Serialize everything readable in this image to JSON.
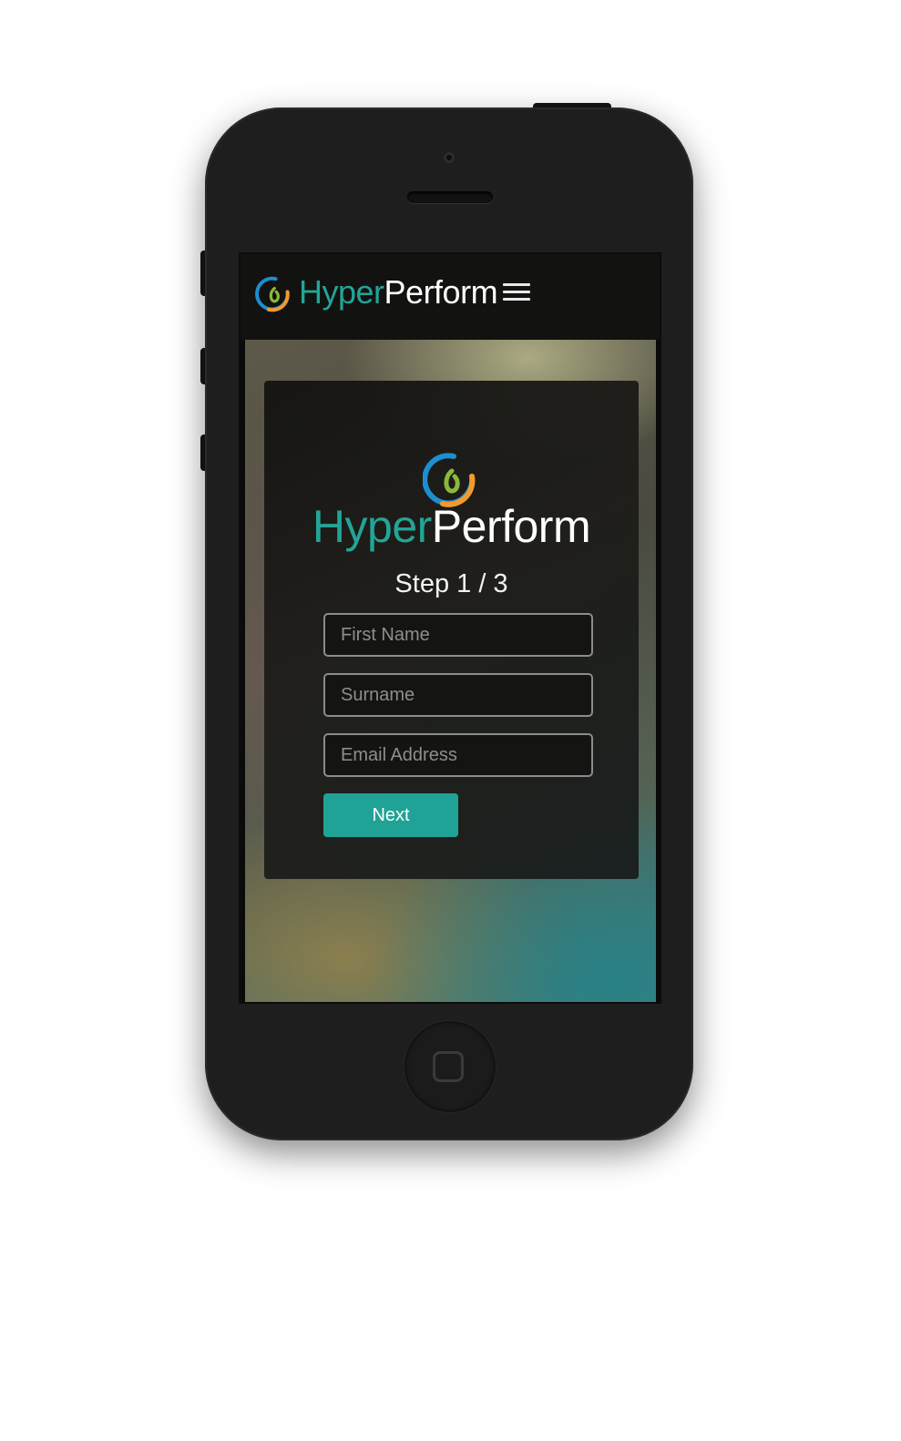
{
  "brand": {
    "part1": "Hyper",
    "part2": "Perform"
  },
  "navbar": {
    "menu_icon": "hamburger-menu-icon"
  },
  "form": {
    "step_label": "Step 1 / 3",
    "fields": [
      {
        "placeholder": "First Name",
        "value": ""
      },
      {
        "placeholder": "Surname",
        "value": ""
      },
      {
        "placeholder": "Email Address",
        "value": ""
      }
    ],
    "next_label": "Next"
  },
  "colors": {
    "accent_teal": "#20a396",
    "logo_blue": "#1c8fd0",
    "logo_orange": "#f29a2e",
    "logo_green": "#8bb83a",
    "device_body": "#1e1e1e"
  }
}
